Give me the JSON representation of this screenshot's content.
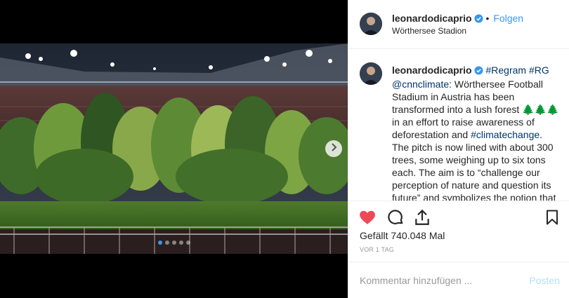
{
  "post": {
    "username": "leonardodicaprio",
    "separator": "•",
    "follow_label": "Folgen",
    "location": "Wörthersee Stadion",
    "caption": {
      "username": "leonardodicaprio",
      "regram": "#Regram",
      "rg": "#RG",
      "source": "@cnnclimate:",
      "text_part1": "Wörthersee Football Stadium in Austria has been transformed into a lush forest ",
      "emoji": "🌲🌲🌲",
      "text_part2": " in an effort to raise awareness of deforestation and ",
      "hashtag": "#climatechange",
      "text_part3": ". The pitch is now lined with about 300 trees, some weighing up to six tons each. The aim is to “challenge our perception of nature and question its future” and symbolizes the notion that nature “may one day only be found in specially"
    },
    "likes": "Gefällt 740.048 Mal",
    "time_ago": "VOR 1 TAG",
    "comment_placeholder": "Kommentar hinzufügen ...",
    "post_button": "Posten",
    "carousel_count": 5,
    "carousel_active": 1
  },
  "icons": {
    "verified": "verified-badge-icon",
    "like": "heart-filled-icon",
    "comment": "comment-bubble-icon",
    "share": "share-send-icon",
    "save": "bookmark-icon",
    "next": "chevron-right-icon"
  },
  "colors": {
    "accent": "#3897f0",
    "like_red": "#ed4956",
    "text": "#262626",
    "muted": "#999999",
    "link": "#003569"
  }
}
